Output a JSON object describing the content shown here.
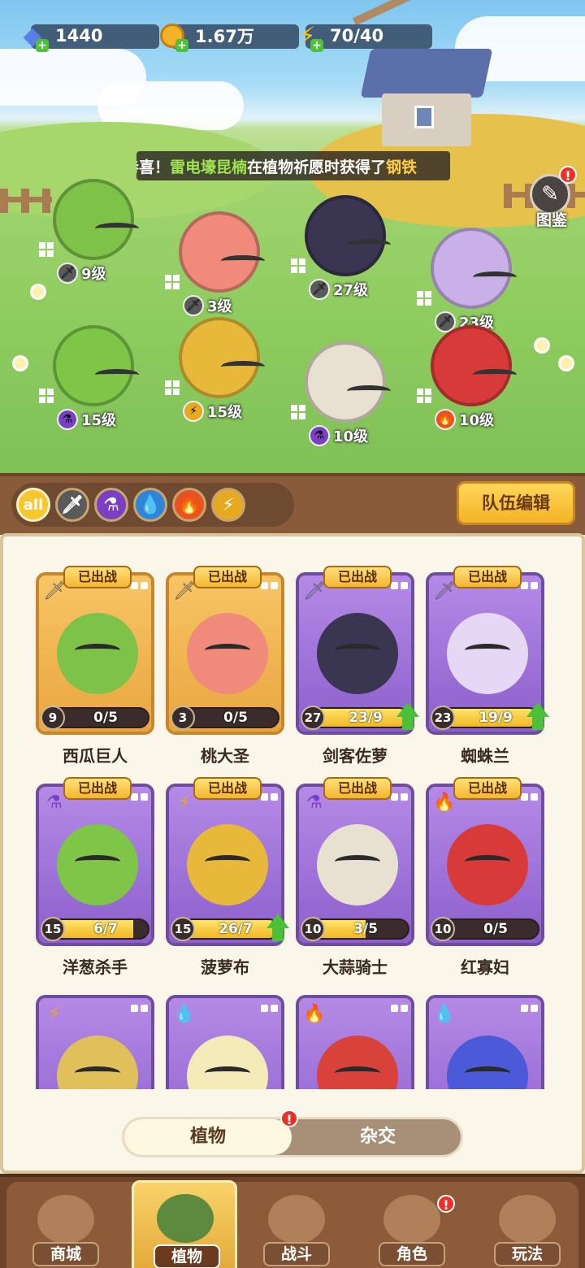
{
  "resources": [
    {
      "name": "diamond",
      "icon": "diamond-icon",
      "value": "1440"
    },
    {
      "name": "coin",
      "icon": "coin-icon",
      "value": "1.67万"
    },
    {
      "name": "energy",
      "icon": "lightning-icon",
      "value": "70/40"
    }
  ],
  "banner": {
    "prefix": "恭喜！",
    "player": "雷电壕昆楠",
    "middle": "在植物祈愿时获得了",
    "item": "钢铁"
  },
  "atlas": {
    "label": "图鉴",
    "badge": "!"
  },
  "field_plants": [
    {
      "level": "9级",
      "type_icon": "sword-icon",
      "color": "#7fc24a"
    },
    {
      "level": "3级",
      "type_icon": "sword-icon",
      "color": "#f08a7a"
    },
    {
      "level": "27级",
      "type_icon": "sword-icon",
      "color": "#3a3550"
    },
    {
      "level": "23级",
      "type_icon": "sword-icon",
      "color": "#c9b0e8"
    },
    {
      "level": "15级",
      "type_icon": "potion-icon",
      "color": "#7ec548"
    },
    {
      "level": "15级",
      "type_icon": "lightning-icon",
      "color": "#e8b83a"
    },
    {
      "level": "10级",
      "type_icon": "potion-icon",
      "color": "#e8e0d0"
    },
    {
      "level": "10级",
      "type_icon": "fire-icon",
      "color": "#d83a3a"
    }
  ],
  "filters": [
    {
      "label": "all",
      "icon": "all-filter"
    },
    {
      "label": "",
      "icon": "sword-icon"
    },
    {
      "label": "",
      "icon": "potion-icon"
    },
    {
      "label": "",
      "icon": "water-icon"
    },
    {
      "label": "",
      "icon": "fire-icon"
    },
    {
      "label": "",
      "icon": "lightning-icon"
    }
  ],
  "team_edit": "队伍编辑",
  "cards": [
    {
      "name": "西瓜巨人",
      "level": "9",
      "progress": "0/5",
      "fill": 0,
      "deployed": "已出战",
      "type": "sword-icon",
      "rarity": "gold",
      "color": "#7fc24a",
      "upgrade": false
    },
    {
      "name": "桃大圣",
      "level": "3",
      "progress": "0/5",
      "fill": 0,
      "deployed": "已出战",
      "type": "sword-icon",
      "rarity": "gold",
      "color": "#f08a7a",
      "upgrade": false
    },
    {
      "name": "剑客佐萝",
      "level": "27",
      "progress": "23/9",
      "fill": 1,
      "deployed": "已出战",
      "type": "sword-icon",
      "rarity": "purple",
      "color": "#3a3550",
      "upgrade": true
    },
    {
      "name": "蜘蛛兰",
      "level": "23",
      "progress": "19/9",
      "fill": 1,
      "deployed": "已出战",
      "type": "sword-icon",
      "rarity": "purple",
      "color": "#e6d8f4",
      "upgrade": true
    },
    {
      "name": "洋葱杀手",
      "level": "15",
      "progress": "6/7",
      "fill": 0.86,
      "deployed": "已出战",
      "type": "potion-icon",
      "rarity": "purple",
      "color": "#7ec548",
      "upgrade": false
    },
    {
      "name": "菠萝布",
      "level": "15",
      "progress": "26/7",
      "fill": 1,
      "deployed": "已出战",
      "type": "lightning-icon",
      "rarity": "purple",
      "color": "#e8b83a",
      "upgrade": true
    },
    {
      "name": "大蒜骑士",
      "level": "10",
      "progress": "3/5",
      "fill": 0.6,
      "deployed": "已出战",
      "type": "potion-icon",
      "rarity": "purple",
      "color": "#e8e0d0",
      "upgrade": false
    },
    {
      "name": "红寡妇",
      "level": "10",
      "progress": "0/5",
      "fill": 0,
      "deployed": "已出战",
      "type": "fire-icon",
      "rarity": "purple",
      "color": "#d83a3a",
      "upgrade": false
    },
    {
      "name": "",
      "level": "",
      "progress": "",
      "fill": 0,
      "deployed": "",
      "type": "lightning-icon",
      "rarity": "purple",
      "color": "#e0c05a",
      "upgrade": false
    },
    {
      "name": "",
      "level": "",
      "progress": "",
      "fill": 0,
      "deployed": "",
      "type": "water-icon",
      "rarity": "purple",
      "color": "#f4eab8",
      "upgrade": false
    },
    {
      "name": "",
      "level": "",
      "progress": "",
      "fill": 0,
      "deployed": "",
      "type": "fire-icon",
      "rarity": "purple",
      "color": "#d8423a",
      "upgrade": false
    },
    {
      "name": "",
      "level": "",
      "progress": "",
      "fill": 0,
      "deployed": "",
      "type": "water-icon",
      "rarity": "purple",
      "color": "#4a5ad8",
      "upgrade": false
    }
  ],
  "toggle": {
    "active": "植物",
    "inactive": "杂交",
    "badge": "!"
  },
  "nav": [
    {
      "label": "商城",
      "icon": "shop-icon",
      "active": false,
      "badge": ""
    },
    {
      "label": "植物",
      "icon": "plants-icon",
      "active": true,
      "badge": ""
    },
    {
      "label": "战斗",
      "icon": "battle-icon",
      "active": false,
      "badge": ""
    },
    {
      "label": "角色",
      "icon": "character-icon",
      "active": false,
      "badge": "!"
    },
    {
      "label": "玩法",
      "icon": "gameplay-icon",
      "active": false,
      "badge": ""
    }
  ],
  "colors": {
    "accent": "#f3b326",
    "wood": "#8a5b3a",
    "card_purple": "#9b6fd6",
    "card_gold": "#f5b548"
  }
}
